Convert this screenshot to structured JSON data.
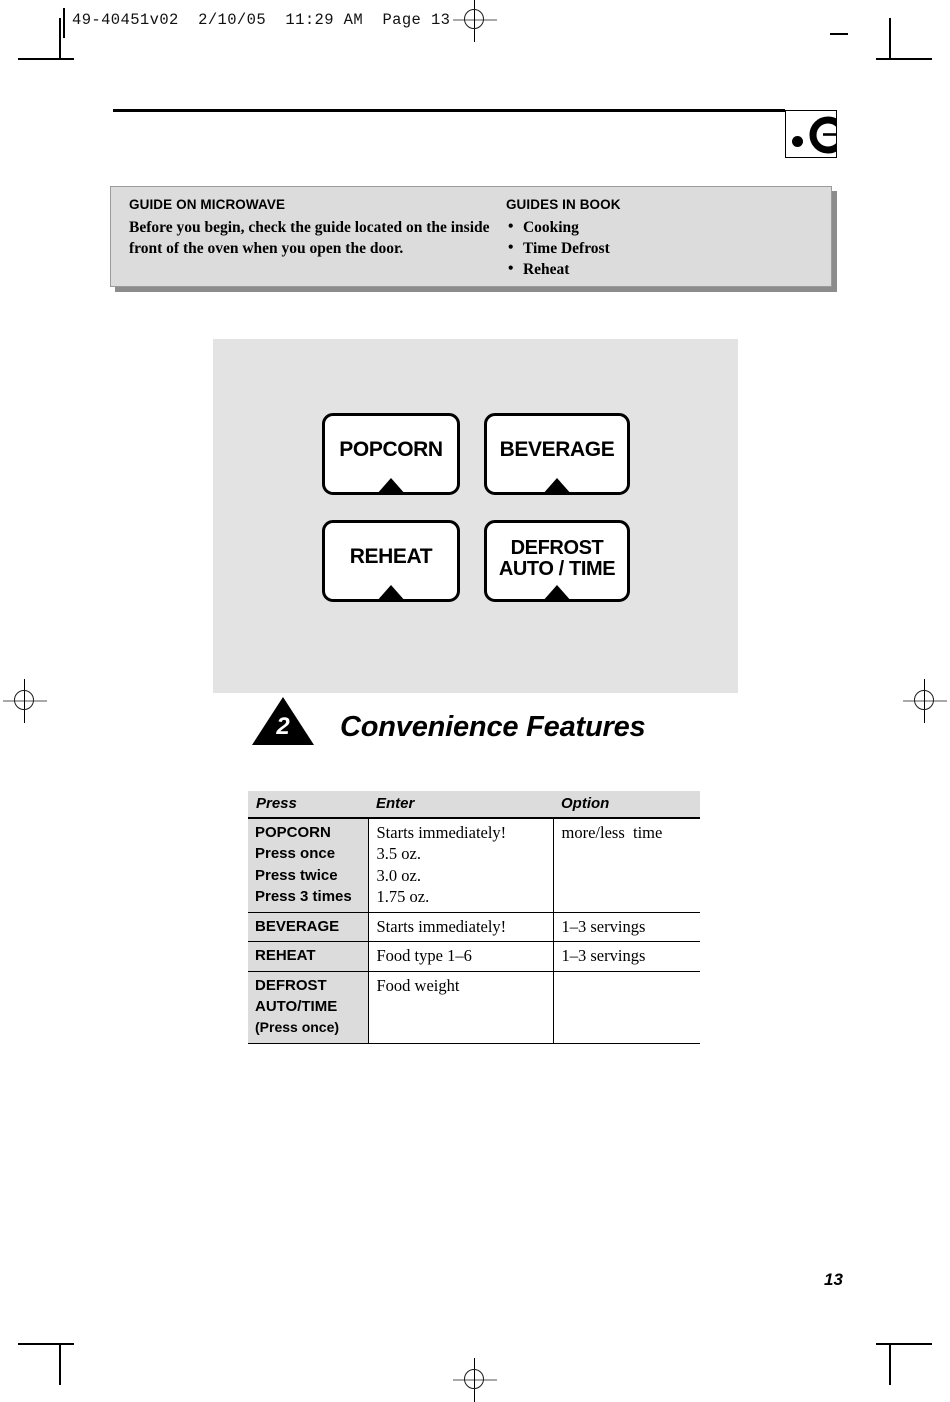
{
  "print_slug": {
    "text": "49-40451v02  2/10/05  11:29 AM  Page 13"
  },
  "logo": {
    "name": "ge-monogram-partial"
  },
  "guides": {
    "left": {
      "title": "GUIDE ON MICROWAVE",
      "body": "Before you begin, check the guide located on the inside front of the oven when you open the door."
    },
    "right": {
      "title": "GUIDES IN BOOK",
      "bullet": "•",
      "items": [
        "Cooking",
        "Time Defrost",
        "Reheat"
      ]
    }
  },
  "control_panel": {
    "buttons": [
      {
        "label": "POPCORN",
        "lines": [
          "POPCORN"
        ]
      },
      {
        "label": "BEVERAGE",
        "lines": [
          "BEVERAGE"
        ]
      },
      {
        "label": "REHEAT",
        "lines": [
          "REHEAT"
        ]
      },
      {
        "label": "DEFROST AUTO / TIME",
        "lines": [
          "DEFROST",
          "AUTO / TIME"
        ]
      }
    ]
  },
  "section": {
    "number": "2",
    "title": "Convenience Features"
  },
  "table": {
    "headers": [
      "Press",
      "Enter",
      "Option"
    ],
    "rows": [
      {
        "press_lines": [
          "POPCORN",
          "Press once",
          "Press twice",
          "Press 3 times"
        ],
        "enter_lines": [
          "Starts immediately!",
          "3.5 oz.",
          "3.0 oz.",
          "1.75 oz."
        ],
        "option_lines": [
          "more/less  time"
        ]
      },
      {
        "press_lines": [
          "BEVERAGE"
        ],
        "enter_lines": [
          "Starts immediately!"
        ],
        "option_lines": [
          "1–3 servings"
        ]
      },
      {
        "press_lines": [
          "REHEAT"
        ],
        "enter_lines": [
          "Food type 1–6"
        ],
        "option_lines": [
          "1–3 servings"
        ]
      },
      {
        "press_lines": [
          "DEFROST",
          "AUTO/TIME",
          "(Press once)"
        ],
        "enter_lines": [
          "Food weight"
        ],
        "option_lines": [
          ""
        ]
      }
    ]
  },
  "page_number": "13",
  "colors": {
    "panel_gray": "#e3e3e3",
    "banner_gray": "#dcdcdc",
    "banner_border": "#9b9b9b",
    "shadow_gray": "#8c8c8c",
    "reg_gray": "#a9a9a9",
    "ink": "#000000"
  }
}
